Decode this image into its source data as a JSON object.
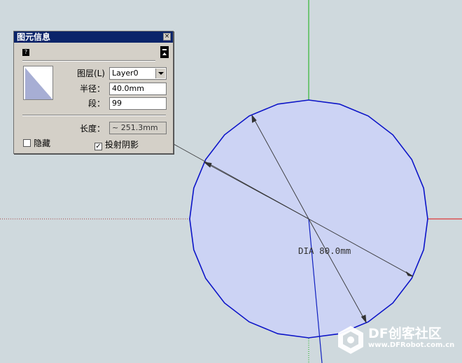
{
  "panel": {
    "title": "图元信息",
    "close_glyph": "×",
    "help_icon": "help-icon",
    "layer_label": "图层(L)",
    "layer_value": "Layer0",
    "radius_label": "半径：",
    "radius_value": "40.0mm",
    "segments_label": "段：",
    "segments_value": "99",
    "length_label": "长度：",
    "length_value": "~ 251.3mm",
    "hidden_label": "隐藏",
    "cast_shadows_label": "投射阴影",
    "hidden_checked": false,
    "cast_shadows_checked": true
  },
  "canvas": {
    "dimension_label": "DIA 80.0mm",
    "circle_fill": "#ccd3f4",
    "circle_stroke": "#0c14c8",
    "axis_red": "#e01010",
    "axis_green": "#10b010",
    "axis_blue": "#1020c0"
  },
  "watermark": {
    "title": "DF创客社区",
    "url": "www.DFRobot.com.cn"
  }
}
